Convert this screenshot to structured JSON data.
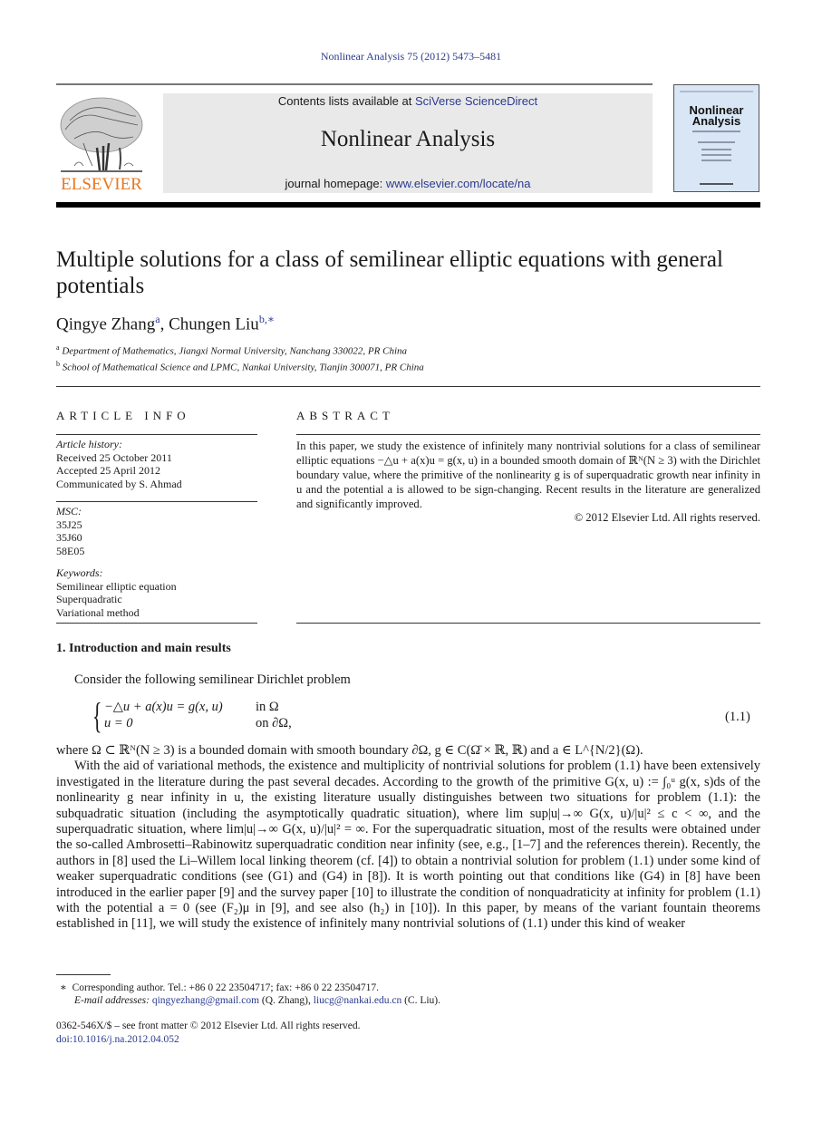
{
  "running_head": "Nonlinear Analysis 75 (2012) 5473–5481",
  "header": {
    "publisher_logo_text": "ELSEVIER",
    "contents_prefix": "Contents lists available at ",
    "contents_link": "SciVerse ScienceDirect",
    "journal_name": "Nonlinear Analysis",
    "homepage_prefix": "journal homepage: ",
    "homepage_link": "www.elsevier.com/locate/na",
    "cover_title_line1": "Nonlinear",
    "cover_title_line2": "Analysis",
    "colors": {
      "logo": "#e8771f",
      "link": "#2b3a8f",
      "box": "#e9e9e9",
      "cover": "#d9e6f5"
    }
  },
  "article": {
    "title": "Multiple solutions for a class of semilinear elliptic equations with general potentials",
    "authors": [
      {
        "name": "Qingye Zhang",
        "sup": "a"
      },
      {
        "name": "Chungen Liu",
        "sup": "b,∗"
      }
    ],
    "affiliations": [
      {
        "sup": "a",
        "text": "Department of Mathematics, Jiangxi Normal University, Nanchang 330022, PR China"
      },
      {
        "sup": "b",
        "text": "School of Mathematical Science and LPMC, Nankai University, Tianjin 300071, PR China"
      }
    ]
  },
  "article_info": {
    "heading": "ARTICLE INFO",
    "history_label": "Article history:",
    "history": [
      "Received 25 October 2011",
      "Accepted 25 April 2012",
      "Communicated by S. Ahmad"
    ],
    "msc_label": "MSC:",
    "msc": [
      "35J25",
      "35J60",
      "58E05"
    ],
    "keywords_label": "Keywords:",
    "keywords": [
      "Semilinear elliptic equation",
      "Superquadratic",
      "Variational method"
    ]
  },
  "abstract": {
    "heading": "ABSTRACT",
    "text": "In this paper, we study the existence of infinitely many nontrivial solutions for a class of semilinear elliptic equations −△u + a(x)u = g(x, u) in a bounded smooth domain of ℝᴺ(N ≥ 3) with the Dirichlet boundary value, where the primitive of the nonlinearity g is of superquadratic growth near infinity in u and the potential a is allowed to be sign-changing. Recent results in the literature are generalized and significantly improved.",
    "copyright": "© 2012 Elsevier Ltd. All rights reserved."
  },
  "section1": {
    "heading": "1.  Introduction and main results",
    "intro": "Consider the following semilinear Dirichlet problem",
    "equation": {
      "line1_lhs": "−△u + a(x)u = g(x, u)",
      "line1_rhs": "in Ω",
      "line2_lhs": "u = 0",
      "line2_rhs": "on ∂Ω,",
      "number": "(1.1)"
    },
    "where_line": "where Ω ⊂ ℝᴺ(N ≥ 3) is a bounded domain with smooth boundary ∂Ω, g ∈ C(Ω̄ × ℝ, ℝ) and a ∈ L^{N/2}(Ω).",
    "paragraph": "With the aid of variational methods, the existence and multiplicity of nontrivial solutions for problem (1.1) have been extensively investigated in the literature during the past several decades. According to the growth of the primitive G(x, u) := ∫₀ᵘ g(x, s)ds of the nonlinearity g near infinity in u, the existing literature usually distinguishes between two situations for problem (1.1): the subquadratic situation (including the asymptotically quadratic situation), where lim sup|u|→∞ G(x, u)/|u|² ≤ c < ∞, and the superquadratic situation, where lim|u|→∞ G(x, u)/|u|² = ∞. For the superquadratic situation, most of the results were obtained under the so-called Ambrosetti–Rabinowitz superquadratic condition near infinity (see, e.g., [1–7] and the references therein). Recently, the authors in [8] used the Li–Willem local linking theorem (cf. [4]) to obtain a nontrivial solution for problem (1.1) under some kind of weaker superquadratic conditions (see (G1) and (G4) in [8]). It is worth pointing out that conditions like (G4) in [8] have been introduced in the earlier paper [9] and the survey paper [10] to illustrate the condition of nonquadraticity at infinity for problem (1.1) with the potential a = 0 (see (F₂)μ in [9], and see also (h₂) in [10]). In this paper, by means of the variant fountain theorems established in [11], we will study the existence of infinitely many nontrivial solutions of (1.1) under this kind of weaker"
  },
  "footnotes": {
    "star": "∗",
    "corresponding": "Corresponding author. Tel.: +86 0 22 23504717; fax: +86 0 22 23504717.",
    "email_label": "E-mail addresses: ",
    "email1": "qingyezhang@gmail.com",
    "email1_owner": " (Q. Zhang), ",
    "email2": "liucg@nankai.edu.cn",
    "email2_owner": " (C. Liu).",
    "front_matter": "0362-546X/$ – see front matter © 2012 Elsevier Ltd. All rights reserved.",
    "doi": "doi:10.1016/j.na.2012.04.052"
  }
}
